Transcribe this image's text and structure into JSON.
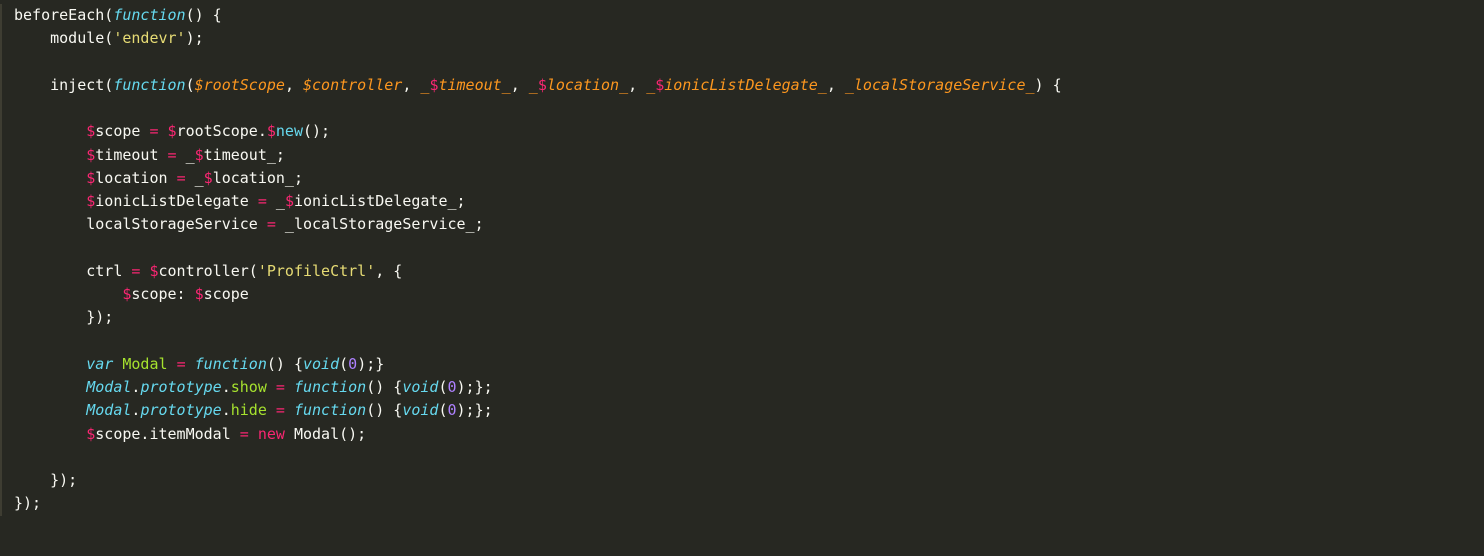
{
  "code": {
    "lines": [
      [
        {
          "t": "beforeEach(",
          "c": "tok-default"
        },
        {
          "t": "function",
          "c": "tok-function"
        },
        {
          "t": "() {",
          "c": "tok-default"
        }
      ],
      [
        {
          "t": "    module(",
          "c": "tok-default"
        },
        {
          "t": "'endevr'",
          "c": "tok-string"
        },
        {
          "t": ");",
          "c": "tok-default"
        }
      ],
      [
        {
          "t": "",
          "c": "tok-default"
        }
      ],
      [
        {
          "t": "    inject(",
          "c": "tok-default"
        },
        {
          "t": "function",
          "c": "tok-function"
        },
        {
          "t": "(",
          "c": "tok-default"
        },
        {
          "t": "$rootScope",
          "c": "tok-param"
        },
        {
          "t": ", ",
          "c": "tok-default"
        },
        {
          "t": "$controller",
          "c": "tok-param"
        },
        {
          "t": ", ",
          "c": "tok-default"
        },
        {
          "t": "_",
          "c": "tok-param"
        },
        {
          "t": "$",
          "c": "tok-keyword-ni"
        },
        {
          "t": "timeout_",
          "c": "tok-param"
        },
        {
          "t": ", ",
          "c": "tok-default"
        },
        {
          "t": "_",
          "c": "tok-param"
        },
        {
          "t": "$",
          "c": "tok-keyword-ni"
        },
        {
          "t": "location_",
          "c": "tok-param"
        },
        {
          "t": ", ",
          "c": "tok-default"
        },
        {
          "t": "_",
          "c": "tok-param"
        },
        {
          "t": "$",
          "c": "tok-keyword-ni"
        },
        {
          "t": "ionicListDelegate_",
          "c": "tok-param"
        },
        {
          "t": ", ",
          "c": "tok-default"
        },
        {
          "t": "_localStorageService_",
          "c": "tok-param"
        },
        {
          "t": ") {",
          "c": "tok-default"
        }
      ],
      [
        {
          "t": "",
          "c": "tok-default"
        }
      ],
      [
        {
          "t": "        ",
          "c": "tok-default"
        },
        {
          "t": "$",
          "c": "tok-keyword-ni"
        },
        {
          "t": "scope ",
          "c": "tok-default"
        },
        {
          "t": "=",
          "c": "tok-keyword-ni"
        },
        {
          "t": " ",
          "c": "tok-default"
        },
        {
          "t": "$",
          "c": "tok-keyword-ni"
        },
        {
          "t": "rootScope.",
          "c": "tok-default"
        },
        {
          "t": "$",
          "c": "tok-keyword-ni"
        },
        {
          "t": "new",
          "c": "tok-support"
        },
        {
          "t": "();",
          "c": "tok-default"
        }
      ],
      [
        {
          "t": "        ",
          "c": "tok-default"
        },
        {
          "t": "$",
          "c": "tok-keyword-ni"
        },
        {
          "t": "timeout ",
          "c": "tok-default"
        },
        {
          "t": "=",
          "c": "tok-keyword-ni"
        },
        {
          "t": " _",
          "c": "tok-default"
        },
        {
          "t": "$",
          "c": "tok-keyword-ni"
        },
        {
          "t": "timeout_;",
          "c": "tok-default"
        }
      ],
      [
        {
          "t": "        ",
          "c": "tok-default"
        },
        {
          "t": "$",
          "c": "tok-keyword-ni"
        },
        {
          "t": "location ",
          "c": "tok-default"
        },
        {
          "t": "=",
          "c": "tok-keyword-ni"
        },
        {
          "t": " _",
          "c": "tok-default"
        },
        {
          "t": "$",
          "c": "tok-keyword-ni"
        },
        {
          "t": "location_;",
          "c": "tok-default"
        }
      ],
      [
        {
          "t": "        ",
          "c": "tok-default"
        },
        {
          "t": "$",
          "c": "tok-keyword-ni"
        },
        {
          "t": "ionicListDelegate ",
          "c": "tok-default"
        },
        {
          "t": "=",
          "c": "tok-keyword-ni"
        },
        {
          "t": " _",
          "c": "tok-default"
        },
        {
          "t": "$",
          "c": "tok-keyword-ni"
        },
        {
          "t": "ionicListDelegate_;",
          "c": "tok-default"
        }
      ],
      [
        {
          "t": "        localStorageService ",
          "c": "tok-default"
        },
        {
          "t": "=",
          "c": "tok-keyword-ni"
        },
        {
          "t": " _localStorageService_;",
          "c": "tok-default"
        }
      ],
      [
        {
          "t": "",
          "c": "tok-default"
        }
      ],
      [
        {
          "t": "        ctrl ",
          "c": "tok-default"
        },
        {
          "t": "=",
          "c": "tok-keyword-ni"
        },
        {
          "t": " ",
          "c": "tok-default"
        },
        {
          "t": "$",
          "c": "tok-keyword-ni"
        },
        {
          "t": "controller(",
          "c": "tok-default"
        },
        {
          "t": "'ProfileCtrl'",
          "c": "tok-string"
        },
        {
          "t": ", {",
          "c": "tok-default"
        }
      ],
      [
        {
          "t": "            ",
          "c": "tok-default"
        },
        {
          "t": "$",
          "c": "tok-keyword-ni"
        },
        {
          "t": "scope: ",
          "c": "tok-default"
        },
        {
          "t": "$",
          "c": "tok-keyword-ni"
        },
        {
          "t": "scope",
          "c": "tok-default"
        }
      ],
      [
        {
          "t": "        });",
          "c": "tok-default"
        }
      ],
      [
        {
          "t": "",
          "c": "tok-default"
        }
      ],
      [
        {
          "t": "        ",
          "c": "tok-default"
        },
        {
          "t": "var",
          "c": "tok-type"
        },
        {
          "t": " ",
          "c": "tok-default"
        },
        {
          "t": "Modal",
          "c": "tok-entity"
        },
        {
          "t": " ",
          "c": "tok-default"
        },
        {
          "t": "=",
          "c": "tok-keyword-ni"
        },
        {
          "t": " ",
          "c": "tok-default"
        },
        {
          "t": "function",
          "c": "tok-function"
        },
        {
          "t": "() {",
          "c": "tok-default"
        },
        {
          "t": "void",
          "c": "tok-type"
        },
        {
          "t": "(",
          "c": "tok-default"
        },
        {
          "t": "0",
          "c": "tok-number"
        },
        {
          "t": ");}",
          "c": "tok-default"
        }
      ],
      [
        {
          "t": "        ",
          "c": "tok-default"
        },
        {
          "t": "Modal",
          "c": "tok-type"
        },
        {
          "t": ".",
          "c": "tok-default"
        },
        {
          "t": "prototype",
          "c": "tok-type"
        },
        {
          "t": ".",
          "c": "tok-default"
        },
        {
          "t": "show",
          "c": "tok-entity"
        },
        {
          "t": " ",
          "c": "tok-default"
        },
        {
          "t": "=",
          "c": "tok-keyword-ni"
        },
        {
          "t": " ",
          "c": "tok-default"
        },
        {
          "t": "function",
          "c": "tok-function"
        },
        {
          "t": "() {",
          "c": "tok-default"
        },
        {
          "t": "void",
          "c": "tok-type"
        },
        {
          "t": "(",
          "c": "tok-default"
        },
        {
          "t": "0",
          "c": "tok-number"
        },
        {
          "t": ");};",
          "c": "tok-default"
        }
      ],
      [
        {
          "t": "        ",
          "c": "tok-default"
        },
        {
          "t": "Modal",
          "c": "tok-type"
        },
        {
          "t": ".",
          "c": "tok-default"
        },
        {
          "t": "prototype",
          "c": "tok-type"
        },
        {
          "t": ".",
          "c": "tok-default"
        },
        {
          "t": "hide",
          "c": "tok-entity"
        },
        {
          "t": " ",
          "c": "tok-default"
        },
        {
          "t": "=",
          "c": "tok-keyword-ni"
        },
        {
          "t": " ",
          "c": "tok-default"
        },
        {
          "t": "function",
          "c": "tok-function"
        },
        {
          "t": "() {",
          "c": "tok-default"
        },
        {
          "t": "void",
          "c": "tok-type"
        },
        {
          "t": "(",
          "c": "tok-default"
        },
        {
          "t": "0",
          "c": "tok-number"
        },
        {
          "t": ");};",
          "c": "tok-default"
        }
      ],
      [
        {
          "t": "        ",
          "c": "tok-default"
        },
        {
          "t": "$",
          "c": "tok-keyword-ni"
        },
        {
          "t": "scope.itemModal ",
          "c": "tok-default"
        },
        {
          "t": "=",
          "c": "tok-keyword-ni"
        },
        {
          "t": " ",
          "c": "tok-default"
        },
        {
          "t": "new",
          "c": "tok-keyword-ni"
        },
        {
          "t": " Modal();",
          "c": "tok-default"
        }
      ],
      [
        {
          "t": "",
          "c": "tok-default"
        }
      ],
      [
        {
          "t": "    });",
          "c": "tok-default"
        }
      ],
      [
        {
          "t": "});",
          "c": "tok-default"
        }
      ]
    ]
  }
}
